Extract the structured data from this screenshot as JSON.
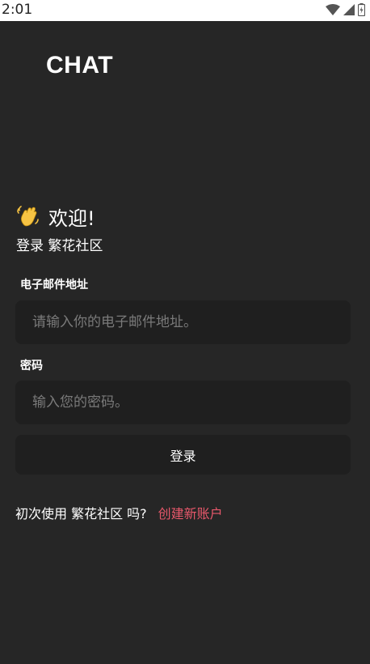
{
  "status_bar": {
    "time": "2:01",
    "icons": [
      "wifi-icon",
      "signal-icon",
      "battery-icon"
    ]
  },
  "app": {
    "logo_text": "CHAT"
  },
  "welcome": {
    "title": "欢迎!",
    "subtitle": "登录 繁花社区",
    "icon": "waving-hand-icon"
  },
  "form": {
    "email_label": "电子邮件地址",
    "email_placeholder": "请输入你的电子邮件地址。",
    "email_value": "",
    "password_label": "密码",
    "password_placeholder": "输入您的密码。",
    "password_value": "",
    "submit_label": "登录"
  },
  "signup": {
    "prompt": "初次使用 繁花社区 吗?",
    "link_label": "创建新账户"
  },
  "colors": {
    "background": "#262626",
    "input_background": "#1f1f1f",
    "link": "#e8586b"
  }
}
